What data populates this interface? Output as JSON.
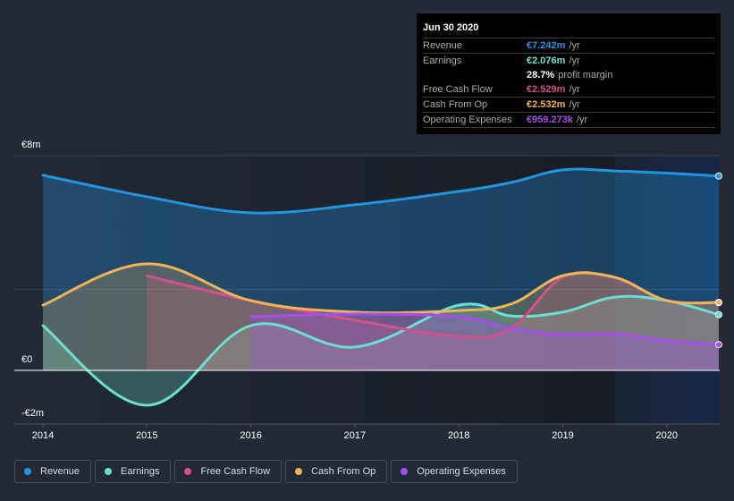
{
  "tooltip": {
    "date": "Jun 30 2020",
    "rows": [
      {
        "label": "Revenue",
        "value": "€7.242m",
        "unit": "/yr",
        "color": "#2394df"
      },
      {
        "label": "Earnings",
        "value": "€2.076m",
        "unit": "/yr",
        "color": "#6ce0d0"
      },
      {
        "label": "",
        "value": "28.7%",
        "unit": "profit margin",
        "color": "#ffffff"
      },
      {
        "label": "Free Cash Flow",
        "value": "€2.529m",
        "unit": "/yr",
        "color": "#d4508c"
      },
      {
        "label": "Cash From Op",
        "value": "€2.532m",
        "unit": "/yr",
        "color": "#f0b35a"
      },
      {
        "label": "Operating Expenses",
        "value": "€959.273k",
        "unit": "/yr",
        "color": "#a54ef0"
      }
    ]
  },
  "chart_data": {
    "type": "area",
    "title": "",
    "xlabel": "",
    "ylabel": "",
    "ylim": [
      -2,
      8
    ],
    "xlim": [
      2014,
      2020.5
    ],
    "y_ticks": [
      {
        "value": 8,
        "label": "€8m"
      },
      {
        "value": 0,
        "label": "€0"
      },
      {
        "value": -2,
        "label": "-€2m"
      }
    ],
    "x_ticks": [
      {
        "value": 2014,
        "label": "2014"
      },
      {
        "value": 2015,
        "label": "2015"
      },
      {
        "value": 2016,
        "label": "2016"
      },
      {
        "value": 2017,
        "label": "2017"
      },
      {
        "value": 2018,
        "label": "2018"
      },
      {
        "value": 2019,
        "label": "2019"
      },
      {
        "value": 2020,
        "label": "2020"
      }
    ],
    "grid": true,
    "highlight_from": 2019.5,
    "legend_position": "bottom-left",
    "series": [
      {
        "name": "Revenue",
        "color": "#2394df",
        "x": [
          2014,
          2015,
          2016,
          2017,
          2018,
          2018.5,
          2019,
          2019.5,
          2020,
          2020.5
        ],
        "values": [
          7.27,
          6.47,
          5.87,
          6.17,
          6.67,
          7.0,
          7.47,
          7.43,
          7.35,
          7.242
        ]
      },
      {
        "name": "Earnings",
        "color": "#6ce0d0",
        "x": [
          2014,
          2015,
          2016,
          2017,
          2018,
          2018.5,
          2019,
          2019.5,
          2020,
          2020.5
        ],
        "values": [
          1.67,
          -1.3,
          1.67,
          0.87,
          2.43,
          2.03,
          2.17,
          2.73,
          2.6,
          2.076
        ]
      },
      {
        "name": "Free Cash Flow",
        "color": "#d4508c",
        "x": [
          2015,
          2016,
          2017,
          2018,
          2018.5,
          2019,
          2019.5,
          2020,
          2020.5
        ],
        "values": [
          3.53,
          2.6,
          1.87,
          1.27,
          1.57,
          3.47,
          3.45,
          2.6,
          2.529
        ]
      },
      {
        "name": "Cash From Op",
        "color": "#f0b35a",
        "x": [
          2014,
          2015,
          2016,
          2017,
          2018,
          2018.5,
          2019,
          2019.5,
          2020,
          2020.5
        ],
        "values": [
          2.43,
          3.97,
          2.6,
          2.17,
          2.23,
          2.47,
          3.53,
          3.47,
          2.6,
          2.532
        ]
      },
      {
        "name": "Operating Expenses",
        "color": "#a54ef0",
        "x": [
          2016,
          2017,
          2018,
          2018.5,
          2019,
          2019.5,
          2020,
          2020.5
        ],
        "values": [
          2.0,
          2.1,
          2.0,
          1.57,
          1.33,
          1.37,
          1.1,
          0.959
        ]
      }
    ]
  },
  "legend": [
    {
      "label": "Revenue",
      "color": "#2394df"
    },
    {
      "label": "Earnings",
      "color": "#6ce0d0"
    },
    {
      "label": "Free Cash Flow",
      "color": "#d4508c"
    },
    {
      "label": "Cash From Op",
      "color": "#f0b35a"
    },
    {
      "label": "Operating Expenses",
      "color": "#a54ef0"
    }
  ]
}
